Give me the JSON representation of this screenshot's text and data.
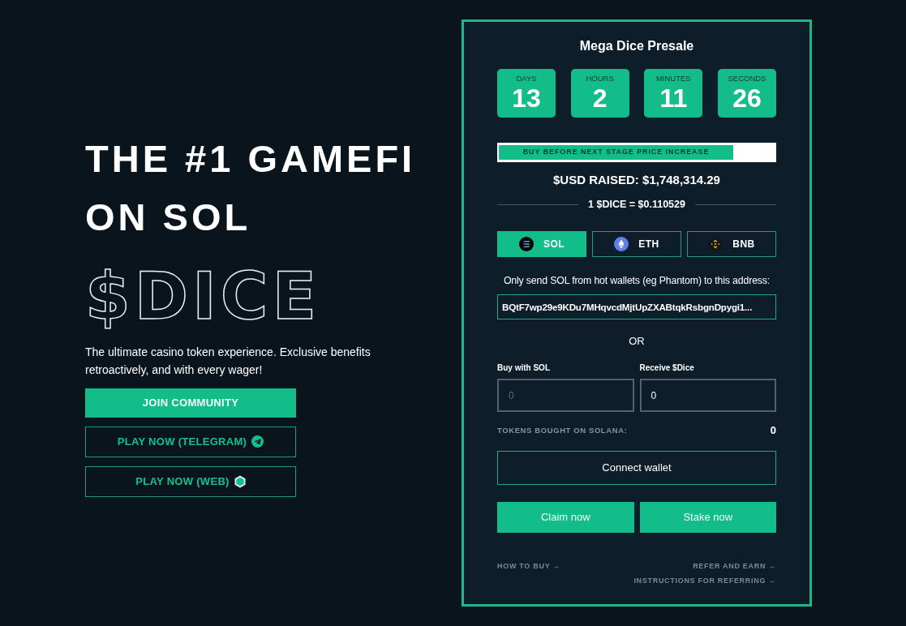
{
  "hero": {
    "headline_lines": [
      "THE #1 GAMEFI",
      "ON SOL"
    ],
    "ticker": "$DICE",
    "description": "The ultimate casino token experience. Exclusive benefits retroactively, and with every wager!",
    "buttons": [
      {
        "label": "JOIN COMMUNITY",
        "kind": "solid"
      },
      {
        "label": "PLAY NOW (TELEGRAM)",
        "kind": "telegram"
      },
      {
        "label": "PLAY NOW (WEB)",
        "kind": "web"
      }
    ]
  },
  "presale": {
    "title": "Mega Dice Presale",
    "countdown": [
      {
        "label": "DAYS",
        "value": "13"
      },
      {
        "label": "HOURS",
        "value": "2"
      },
      {
        "label": "MINUTES",
        "value": "11"
      },
      {
        "label": "SECONDS",
        "value": "26"
      }
    ],
    "progress": {
      "label": "BUY BEFORE NEXT STAGE PRICE INCREASE",
      "level": 0.85
    },
    "raised": "$USD RAISED: $1,748,314.29",
    "rate": "1 $DICE = $0.110529",
    "currencies": [
      {
        "label": "SOL",
        "kind": "sol",
        "selected": true
      },
      {
        "label": "ETH",
        "kind": "eth",
        "selected": false
      },
      {
        "label": "BNB",
        "kind": "bnb",
        "selected": false
      }
    ],
    "note": "Only send SOL from hot wallets (eg Phantom) to this address:",
    "address": "BQtF7wp29e9KDu7MHqvcdMjtUpZXABtqkRsbgnDpygi1...",
    "separator": "OR",
    "inputs": [
      {
        "label": "Buy with SOL",
        "placeholder": "0"
      },
      {
        "label": "Receive $Dice",
        "value": "0"
      }
    ],
    "tokens_bought": {
      "label": "TOKENS BOUGHT ON SOLANA:",
      "value": "0"
    },
    "connect_button": "Connect wallet",
    "action_buttons": [
      "Claim now",
      "Stake now"
    ],
    "footer_links": {
      "left": [
        "HOW TO BUY →"
      ],
      "right": [
        "REFER AND EARN →",
        "INSTRUCTIONS FOR REFERRING →"
      ]
    }
  }
}
